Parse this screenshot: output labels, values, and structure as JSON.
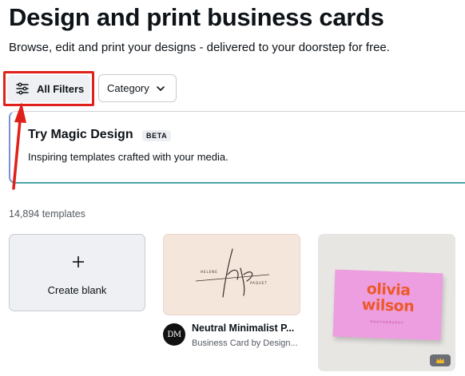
{
  "header": {
    "title": "Design and print business cards",
    "subtitle": "Browse, edit and print your designs - delivered to your doorstep for free."
  },
  "filters": {
    "all_filters_label": "All Filters",
    "category_label": "Category"
  },
  "magic_design": {
    "title": "Try Magic Design",
    "badge": "BETA",
    "description": "Inspiring templates crafted with your media."
  },
  "templates": {
    "count_text": "14,894 templates",
    "create_blank_label": "Create blank",
    "items": [
      {
        "title": "Neutral Minimalist P...",
        "subtitle": "Business Card by Design...",
        "avatar_text": "DM",
        "thumb_text_left": "HELENE",
        "thumb_text_right": "PAQUET",
        "thumb_monogram": "hp"
      },
      {
        "card_name_line1": "olivia",
        "card_name_line2": "wilson",
        "card_subtext": "PHOTOGRAPHY",
        "premium_icon": "crown-icon"
      }
    ]
  },
  "colors": {
    "highlight": "#e0201a",
    "accent_pink": "#ec9ee0",
    "accent_orange": "#ec5a2a"
  }
}
